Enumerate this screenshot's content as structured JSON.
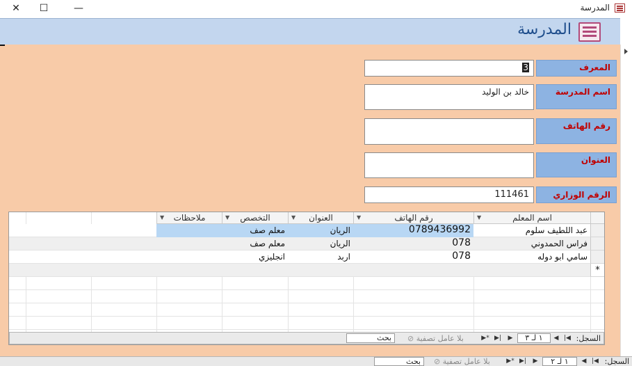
{
  "window": {
    "title": "المدرسة",
    "close_glyph": "✕",
    "maximize_glyph": "☐",
    "minimize_glyph": "—"
  },
  "header": {
    "title": "المدرسة"
  },
  "form": {
    "id_label": "المعرف",
    "id_value": "3",
    "school_name_label": "اسم المدرسة",
    "school_name_value": "خالد بن الوليد",
    "phone_label": "رقم الهاتف",
    "phone_value": "",
    "address_label": "العنوان",
    "address_value": "",
    "ministry_number_label": "الرقم الوزاري",
    "ministry_number_value": "111461"
  },
  "teachers_table": {
    "columns": [
      "اسم المعلم",
      "رقم الهاتف",
      "العنوان",
      "التخصص",
      "ملاحظات"
    ],
    "rows": [
      {
        "name": "عبد اللطيف سلوم",
        "phone": "0789436992",
        "address": "الريان",
        "specialty": "معلم صف",
        "notes": ""
      },
      {
        "name": "فراس الحمدوني",
        "phone": "078",
        "address": "الريان",
        "specialty": "معلم صف",
        "notes": ""
      },
      {
        "name": "سامي ابو دوله",
        "phone": "078",
        "address": "اربد",
        "specialty": "انجليزي",
        "notes": ""
      }
    ],
    "new_row_marker": "*",
    "nav": {
      "record_label": "السجل:",
      "counter": "١ لـ ٣",
      "no_filter": "بلا عامل تصفية",
      "search": "بحث"
    }
  },
  "main_nav": {
    "record_label": "السجل:",
    "counter": "١ لـ ٢",
    "no_filter": "بلا عامل تصفية",
    "search": "بحث"
  },
  "icons": {
    "first": "first-record-icon",
    "prev": "previous-record-icon",
    "next": "next-record-icon",
    "last": "last-record-icon",
    "new": "new-record-icon",
    "filter": "filter-icon"
  }
}
